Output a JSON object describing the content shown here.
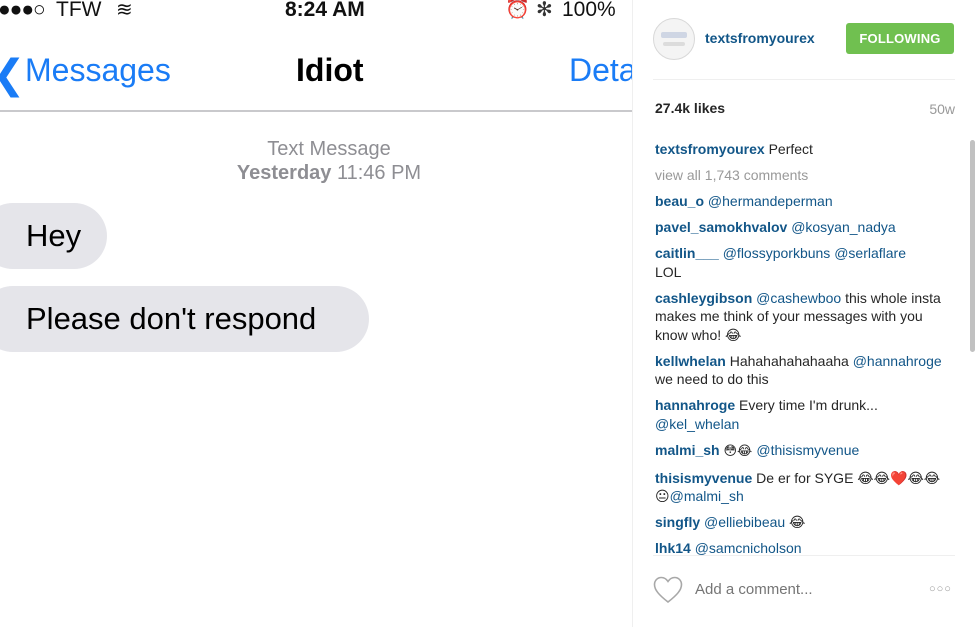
{
  "message_screenshot": {
    "status_bar": {
      "signal_glyphs": "●●●○",
      "carrier": "TFW",
      "wifi_glyph": "≋",
      "time": "8:24 AM",
      "alarm_glyph": "⏰",
      "bluetooth_glyph": "✻",
      "battery": "100%"
    },
    "nav": {
      "back_chevron": "❮",
      "back_label": "Messages",
      "title": "Idiot",
      "details_label": "Details"
    },
    "meta": {
      "type": "Text Message",
      "day": "Yesterday",
      "time": "11:46 PM"
    },
    "messages": [
      "Hey",
      "Please don't respond"
    ],
    "bubble_color": "#e5e5ea",
    "accent_color": "#1a7cf6"
  },
  "post": {
    "username": "textsfromyourex",
    "follow_label": "FOLLOWING",
    "likes": "27.4k likes",
    "age": "50w",
    "caption": {
      "user": "textsfromyourex",
      "text": "Perfect"
    },
    "view_all": "view all 1,743 comments",
    "comments": [
      {
        "user": "beau_o",
        "text": "@hermandeperman"
      },
      {
        "user": "pavel_samokhvalov",
        "text": "@kosyan_nadya"
      },
      {
        "user": "caitlin___",
        "text": "@flossyporkbuns @serlaflare",
        "extra": "LOL"
      },
      {
        "user": "cashleygibson",
        "mention": "@cashewboo",
        "text": " this whole insta makes me think of your messages with you know who! 😂"
      },
      {
        "user": "kellwhelan",
        "text": "Hahahahahahaaha ",
        "mention": "@hannahroge",
        "text2": " we need to do this"
      },
      {
        "user": "hannahroge",
        "text": "Every time I'm drunk... ",
        "mention": "@kel_whelan"
      },
      {
        "user": "malmi_sh",
        "text": "😳😂 ",
        "mention": "@thisismyvenue"
      },
      {
        "user": "thisismyvenue",
        "text": "De er for SYGE 😂😂❤️😂😂😐",
        "mention": "@malmi_sh"
      },
      {
        "user": "singfly",
        "mention": "@elliebibeau",
        "text": " 😂"
      },
      {
        "user": "lhk14",
        "mention": "@samcnicholson"
      }
    ],
    "add_comment_placeholder": "Add a comment...",
    "more_glyph": "○○○",
    "follow_color": "#70c050",
    "link_color": "#125688"
  }
}
